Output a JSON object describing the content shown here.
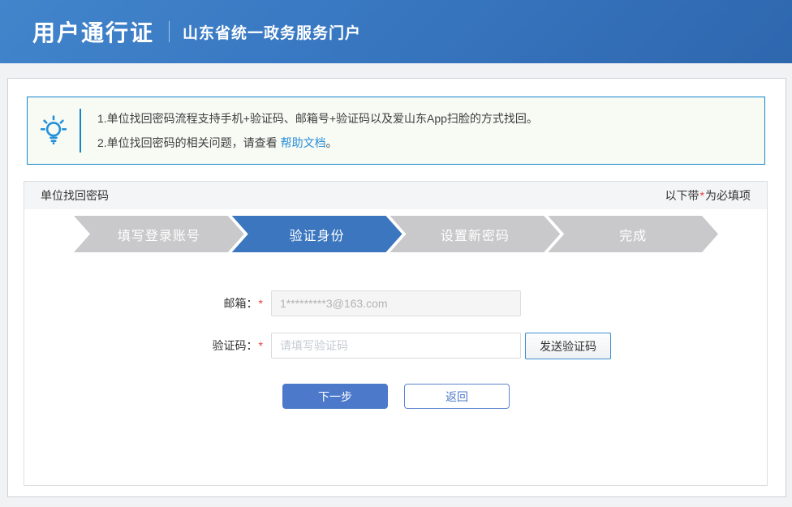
{
  "header": {
    "title": "用户通行证",
    "subtitle": "山东省统一政务服务门户"
  },
  "tip": {
    "line1": "1.单位找回密码流程支持手机+验证码、邮箱号+验证码以及爱山东App扫脸的方式找回。",
    "line2_prefix": "2.单位找回密码的相关问题，请查看 ",
    "line2_link": "帮助文档",
    "line2_suffix": "。"
  },
  "section": {
    "title": "单位找回密码",
    "required_note_prefix": "以下带",
    "required_star": "*",
    "required_note_suffix": "为必填项"
  },
  "steps": [
    {
      "label": "填写登录账号",
      "state": "done"
    },
    {
      "label": "验证身份",
      "state": "active"
    },
    {
      "label": "设置新密码",
      "state": "pending"
    },
    {
      "label": "完成",
      "state": "pending"
    }
  ],
  "form": {
    "email_label": "邮箱：",
    "email_required": "*",
    "email_value": "1*********3@163.com",
    "code_label": "验证码：",
    "code_required": "*",
    "code_placeholder": "请填写验证码",
    "send_code_button": "发送验证码",
    "next_button": "下一步",
    "back_button": "返回"
  },
  "colors": {
    "header_blue": "#3a7ac4",
    "tip_border_blue": "#1287cb",
    "link_blue": "#2b8fd6",
    "step_active_blue": "#3b76bf",
    "step_gray": "#c9c9cb",
    "primary_button_blue": "#4d79ca",
    "required_red": "#e8413c"
  }
}
